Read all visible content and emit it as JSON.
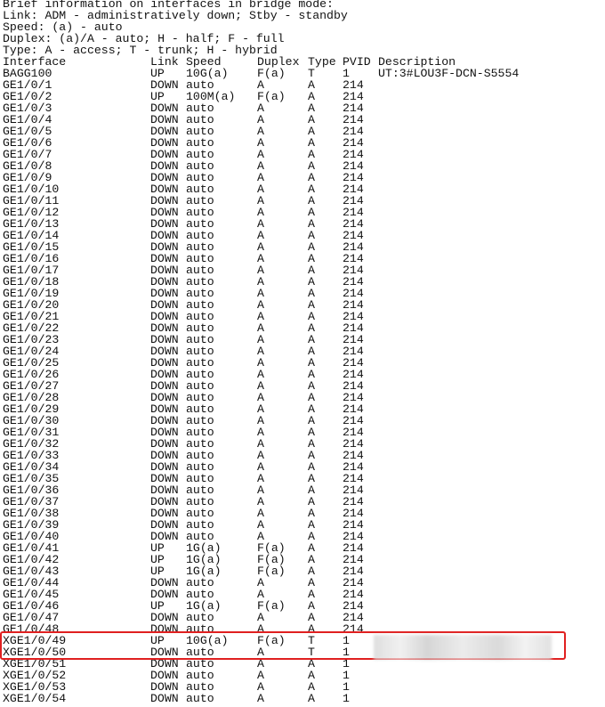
{
  "legend": [
    "Brief information on interfaces in bridge mode:",
    "Link: ADM - administratively down; Stby - standby",
    "Speed: (a) - auto",
    "Duplex: (a)/A - auto; H - half; F - full",
    "Type: A - access; T - trunk; H - hybrid"
  ],
  "headers": {
    "interface": "Interface",
    "link": "Link",
    "speed": "Speed",
    "duplex": "Duplex",
    "type": "Type",
    "pvid": "PVID",
    "description": "Description"
  },
  "rows": [
    {
      "interface": "BAGG100",
      "link": "UP",
      "speed": "10G(a)",
      "duplex": "F(a)",
      "type": "T",
      "pvid": "1",
      "description": "UT:3#LOU3F-DCN-S5554"
    },
    {
      "interface": "GE1/0/1",
      "link": "DOWN",
      "speed": "auto",
      "duplex": "A",
      "type": "A",
      "pvid": "214",
      "description": ""
    },
    {
      "interface": "GE1/0/2",
      "link": "UP",
      "speed": "100M(a)",
      "duplex": "F(a)",
      "type": "A",
      "pvid": "214",
      "description": ""
    },
    {
      "interface": "GE1/0/3",
      "link": "DOWN",
      "speed": "auto",
      "duplex": "A",
      "type": "A",
      "pvid": "214",
      "description": ""
    },
    {
      "interface": "GE1/0/4",
      "link": "DOWN",
      "speed": "auto",
      "duplex": "A",
      "type": "A",
      "pvid": "214",
      "description": ""
    },
    {
      "interface": "GE1/0/5",
      "link": "DOWN",
      "speed": "auto",
      "duplex": "A",
      "type": "A",
      "pvid": "214",
      "description": ""
    },
    {
      "interface": "GE1/0/6",
      "link": "DOWN",
      "speed": "auto",
      "duplex": "A",
      "type": "A",
      "pvid": "214",
      "description": ""
    },
    {
      "interface": "GE1/0/7",
      "link": "DOWN",
      "speed": "auto",
      "duplex": "A",
      "type": "A",
      "pvid": "214",
      "description": ""
    },
    {
      "interface": "GE1/0/8",
      "link": "DOWN",
      "speed": "auto",
      "duplex": "A",
      "type": "A",
      "pvid": "214",
      "description": ""
    },
    {
      "interface": "GE1/0/9",
      "link": "DOWN",
      "speed": "auto",
      "duplex": "A",
      "type": "A",
      "pvid": "214",
      "description": ""
    },
    {
      "interface": "GE1/0/10",
      "link": "DOWN",
      "speed": "auto",
      "duplex": "A",
      "type": "A",
      "pvid": "214",
      "description": ""
    },
    {
      "interface": "GE1/0/11",
      "link": "DOWN",
      "speed": "auto",
      "duplex": "A",
      "type": "A",
      "pvid": "214",
      "description": ""
    },
    {
      "interface": "GE1/0/12",
      "link": "DOWN",
      "speed": "auto",
      "duplex": "A",
      "type": "A",
      "pvid": "214",
      "description": ""
    },
    {
      "interface": "GE1/0/13",
      "link": "DOWN",
      "speed": "auto",
      "duplex": "A",
      "type": "A",
      "pvid": "214",
      "description": ""
    },
    {
      "interface": "GE1/0/14",
      "link": "DOWN",
      "speed": "auto",
      "duplex": "A",
      "type": "A",
      "pvid": "214",
      "description": ""
    },
    {
      "interface": "GE1/0/15",
      "link": "DOWN",
      "speed": "auto",
      "duplex": "A",
      "type": "A",
      "pvid": "214",
      "description": ""
    },
    {
      "interface": "GE1/0/16",
      "link": "DOWN",
      "speed": "auto",
      "duplex": "A",
      "type": "A",
      "pvid": "214",
      "description": ""
    },
    {
      "interface": "GE1/0/17",
      "link": "DOWN",
      "speed": "auto",
      "duplex": "A",
      "type": "A",
      "pvid": "214",
      "description": ""
    },
    {
      "interface": "GE1/0/18",
      "link": "DOWN",
      "speed": "auto",
      "duplex": "A",
      "type": "A",
      "pvid": "214",
      "description": ""
    },
    {
      "interface": "GE1/0/19",
      "link": "DOWN",
      "speed": "auto",
      "duplex": "A",
      "type": "A",
      "pvid": "214",
      "description": ""
    },
    {
      "interface": "GE1/0/20",
      "link": "DOWN",
      "speed": "auto",
      "duplex": "A",
      "type": "A",
      "pvid": "214",
      "description": ""
    },
    {
      "interface": "GE1/0/21",
      "link": "DOWN",
      "speed": "auto",
      "duplex": "A",
      "type": "A",
      "pvid": "214",
      "description": ""
    },
    {
      "interface": "GE1/0/22",
      "link": "DOWN",
      "speed": "auto",
      "duplex": "A",
      "type": "A",
      "pvid": "214",
      "description": ""
    },
    {
      "interface": "GE1/0/23",
      "link": "DOWN",
      "speed": "auto",
      "duplex": "A",
      "type": "A",
      "pvid": "214",
      "description": ""
    },
    {
      "interface": "GE1/0/24",
      "link": "DOWN",
      "speed": "auto",
      "duplex": "A",
      "type": "A",
      "pvid": "214",
      "description": ""
    },
    {
      "interface": "GE1/0/25",
      "link": "DOWN",
      "speed": "auto",
      "duplex": "A",
      "type": "A",
      "pvid": "214",
      "description": ""
    },
    {
      "interface": "GE1/0/26",
      "link": "DOWN",
      "speed": "auto",
      "duplex": "A",
      "type": "A",
      "pvid": "214",
      "description": ""
    },
    {
      "interface": "GE1/0/27",
      "link": "DOWN",
      "speed": "auto",
      "duplex": "A",
      "type": "A",
      "pvid": "214",
      "description": ""
    },
    {
      "interface": "GE1/0/28",
      "link": "DOWN",
      "speed": "auto",
      "duplex": "A",
      "type": "A",
      "pvid": "214",
      "description": ""
    },
    {
      "interface": "GE1/0/29",
      "link": "DOWN",
      "speed": "auto",
      "duplex": "A",
      "type": "A",
      "pvid": "214",
      "description": ""
    },
    {
      "interface": "GE1/0/30",
      "link": "DOWN",
      "speed": "auto",
      "duplex": "A",
      "type": "A",
      "pvid": "214",
      "description": ""
    },
    {
      "interface": "GE1/0/31",
      "link": "DOWN",
      "speed": "auto",
      "duplex": "A",
      "type": "A",
      "pvid": "214",
      "description": ""
    },
    {
      "interface": "GE1/0/32",
      "link": "DOWN",
      "speed": "auto",
      "duplex": "A",
      "type": "A",
      "pvid": "214",
      "description": ""
    },
    {
      "interface": "GE1/0/33",
      "link": "DOWN",
      "speed": "auto",
      "duplex": "A",
      "type": "A",
      "pvid": "214",
      "description": ""
    },
    {
      "interface": "GE1/0/34",
      "link": "DOWN",
      "speed": "auto",
      "duplex": "A",
      "type": "A",
      "pvid": "214",
      "description": ""
    },
    {
      "interface": "GE1/0/35",
      "link": "DOWN",
      "speed": "auto",
      "duplex": "A",
      "type": "A",
      "pvid": "214",
      "description": ""
    },
    {
      "interface": "GE1/0/36",
      "link": "DOWN",
      "speed": "auto",
      "duplex": "A",
      "type": "A",
      "pvid": "214",
      "description": ""
    },
    {
      "interface": "GE1/0/37",
      "link": "DOWN",
      "speed": "auto",
      "duplex": "A",
      "type": "A",
      "pvid": "214",
      "description": ""
    },
    {
      "interface": "GE1/0/38",
      "link": "DOWN",
      "speed": "auto",
      "duplex": "A",
      "type": "A",
      "pvid": "214",
      "description": ""
    },
    {
      "interface": "GE1/0/39",
      "link": "DOWN",
      "speed": "auto",
      "duplex": "A",
      "type": "A",
      "pvid": "214",
      "description": ""
    },
    {
      "interface": "GE1/0/40",
      "link": "DOWN",
      "speed": "auto",
      "duplex": "A",
      "type": "A",
      "pvid": "214",
      "description": ""
    },
    {
      "interface": "GE1/0/41",
      "link": "UP",
      "speed": "1G(a)",
      "duplex": "F(a)",
      "type": "A",
      "pvid": "214",
      "description": ""
    },
    {
      "interface": "GE1/0/42",
      "link": "UP",
      "speed": "1G(a)",
      "duplex": "F(a)",
      "type": "A",
      "pvid": "214",
      "description": ""
    },
    {
      "interface": "GE1/0/43",
      "link": "UP",
      "speed": "1G(a)",
      "duplex": "F(a)",
      "type": "A",
      "pvid": "214",
      "description": ""
    },
    {
      "interface": "GE1/0/44",
      "link": "DOWN",
      "speed": "auto",
      "duplex": "A",
      "type": "A",
      "pvid": "214",
      "description": ""
    },
    {
      "interface": "GE1/0/45",
      "link": "DOWN",
      "speed": "auto",
      "duplex": "A",
      "type": "A",
      "pvid": "214",
      "description": ""
    },
    {
      "interface": "GE1/0/46",
      "link": "UP",
      "speed": "1G(a)",
      "duplex": "F(a)",
      "type": "A",
      "pvid": "214",
      "description": ""
    },
    {
      "interface": "GE1/0/47",
      "link": "DOWN",
      "speed": "auto",
      "duplex": "A",
      "type": "A",
      "pvid": "214",
      "description": ""
    },
    {
      "interface": "GE1/0/48",
      "link": "DOWN",
      "speed": "auto",
      "duplex": "A",
      "type": "A",
      "pvid": "214",
      "description": ""
    },
    {
      "interface": "XGE1/0/49",
      "link": "UP",
      "speed": "10G(a)",
      "duplex": "F(a)",
      "type": "T",
      "pvid": "1",
      "description": ""
    },
    {
      "interface": "XGE1/0/50",
      "link": "DOWN",
      "speed": "auto",
      "duplex": "A",
      "type": "T",
      "pvid": "1",
      "description": ""
    },
    {
      "interface": "XGE1/0/51",
      "link": "DOWN",
      "speed": "auto",
      "duplex": "A",
      "type": "A",
      "pvid": "1",
      "description": ""
    },
    {
      "interface": "XGE1/0/52",
      "link": "DOWN",
      "speed": "auto",
      "duplex": "A",
      "type": "A",
      "pvid": "1",
      "description": ""
    },
    {
      "interface": "XGE1/0/53",
      "link": "DOWN",
      "speed": "auto",
      "duplex": "A",
      "type": "A",
      "pvid": "1",
      "description": ""
    },
    {
      "interface": "XGE1/0/54",
      "link": "DOWN",
      "speed": "auto",
      "duplex": "A",
      "type": "A",
      "pvid": "1",
      "description": ""
    }
  ],
  "colors": {
    "text": "#111111",
    "background": "#ffffff",
    "highlight_border": "#e02020"
  }
}
